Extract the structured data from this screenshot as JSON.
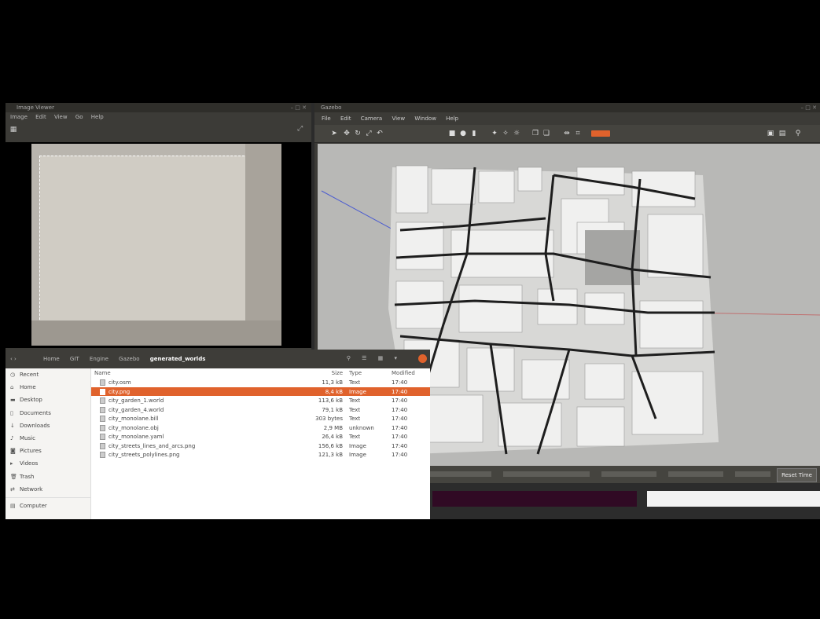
{
  "image_viewer": {
    "title": "Image Viewer",
    "menu": [
      "Image",
      "Edit",
      "View",
      "Go",
      "Help"
    ]
  },
  "gazebo": {
    "title": "Gazebo",
    "menu": [
      "File",
      "Edit",
      "Camera",
      "View",
      "Window",
      "Help"
    ],
    "reset_label": "Reset Time"
  },
  "file_manager": {
    "breadcrumbs": [
      "Home",
      "GIT",
      "Engine",
      "Gazebo",
      "generated_worlds"
    ],
    "sidebar": [
      {
        "label": "Recent",
        "icon": "clock-icon"
      },
      {
        "label": "Home",
        "icon": "home-icon"
      },
      {
        "label": "Desktop",
        "icon": "desktop-icon"
      },
      {
        "label": "Documents",
        "icon": "document-icon"
      },
      {
        "label": "Downloads",
        "icon": "download-icon"
      },
      {
        "label": "Music",
        "icon": "music-icon"
      },
      {
        "label": "Pictures",
        "icon": "picture-icon"
      },
      {
        "label": "Videos",
        "icon": "video-icon"
      },
      {
        "label": "Trash",
        "icon": "trash-icon"
      },
      {
        "label": "Network",
        "icon": "network-icon"
      },
      {
        "label": "Computer",
        "icon": "computer-icon"
      }
    ],
    "columns": {
      "name": "Name",
      "size": "Size",
      "type": "Type",
      "modified": "Modified"
    },
    "files": [
      {
        "name": "city.osm",
        "size": "11,3 kB",
        "type": "Text",
        "modified": "17:40"
      },
      {
        "name": "city.png",
        "size": "8,4 kB",
        "type": "Image",
        "modified": "17:40",
        "selected": true
      },
      {
        "name": "city_garden_1.world",
        "size": "113,6 kB",
        "type": "Text",
        "modified": "17:40"
      },
      {
        "name": "city_garden_4.world",
        "size": "79,1 kB",
        "type": "Text",
        "modified": "17:40"
      },
      {
        "name": "city_monolane.bill",
        "size": "303 bytes",
        "type": "Text",
        "modified": "17:40"
      },
      {
        "name": "city_monolane.obj",
        "size": "2,9 MB",
        "type": "unknown",
        "modified": "17:40"
      },
      {
        "name": "city_monolane.yaml",
        "size": "26,4 kB",
        "type": "Text",
        "modified": "17:40"
      },
      {
        "name": "city_streets_lines_and_arcs.png",
        "size": "156,6 kB",
        "type": "Image",
        "modified": "17:40"
      },
      {
        "name": "city_streets_polylines.png",
        "size": "121,3 kB",
        "type": "Image",
        "modified": "17:40"
      }
    ]
  }
}
